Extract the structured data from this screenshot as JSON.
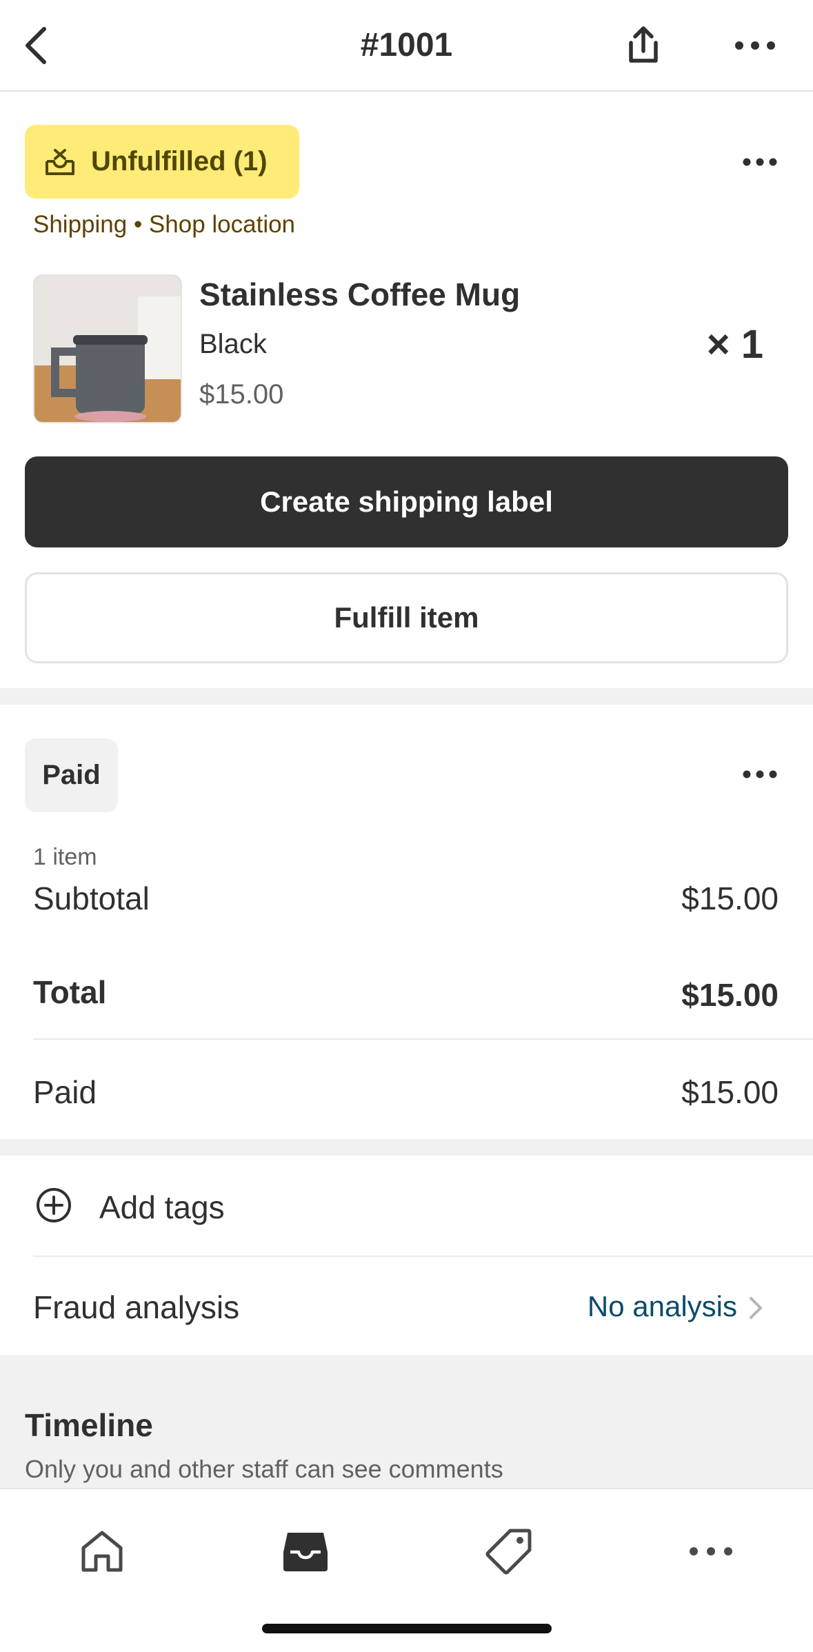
{
  "header": {
    "title": "#1001",
    "back_icon": "chevron-left-icon",
    "share_icon": "share-icon",
    "more_icon": "ellipsis-icon"
  },
  "fulfillment": {
    "status_label": "Unfulfilled (1)",
    "status_icon": "unfulfilled-box-icon",
    "status_color": "#ffeb78",
    "shipping_text": "Shipping • Shop location",
    "product": {
      "name": "Stainless Coffee Mug",
      "variant": "Black",
      "price": "$15.00",
      "quantity": "× 1"
    },
    "primary_button": "Create shipping label",
    "secondary_button": "Fulfill item"
  },
  "payment": {
    "status_label": "Paid",
    "items_count": "1 item",
    "subtotal_label": "Subtotal",
    "subtotal_value": "$15.00",
    "total_label": "Total",
    "total_value": "$15.00",
    "paid_label": "Paid",
    "paid_value": "$15.00"
  },
  "tags": {
    "add_label": "Add tags"
  },
  "fraud": {
    "label": "Fraud analysis",
    "value": "No analysis"
  },
  "timeline": {
    "title": "Timeline",
    "subtitle": "Only you and other staff can see comments"
  },
  "tabbar": {
    "items": [
      "home-icon",
      "orders-inbox-icon",
      "products-tag-icon",
      "more-icon"
    ],
    "active_index": 1
  },
  "colors": {
    "primary_button": "#303030",
    "link": "#0b4b6b",
    "section_gap": "#f1f1f1"
  }
}
